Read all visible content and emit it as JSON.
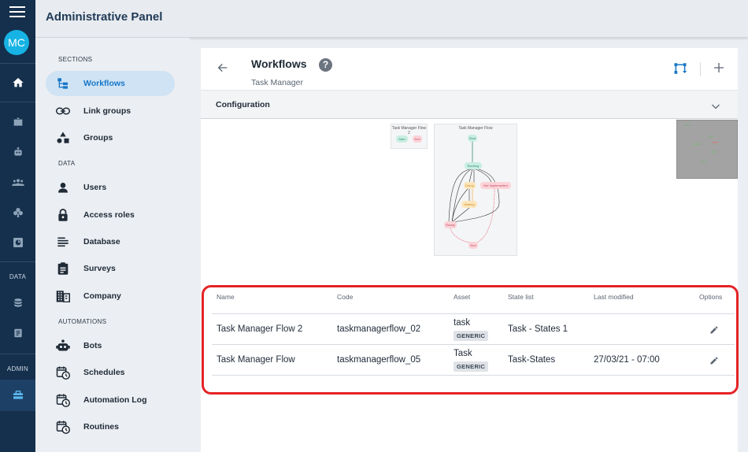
{
  "app": {
    "title": "Administrative Panel"
  },
  "rail": {
    "avatar_initials": "MC",
    "data_label": "DATA",
    "admin_label": "ADMIN"
  },
  "sidebar": {
    "sections_label": "SECTIONS",
    "data_label": "DATA",
    "automations_label": "AUTOMATIONS",
    "sections": [
      {
        "label": "Workflows",
        "icon": "workflow-icon",
        "active": true
      },
      {
        "label": "Link groups",
        "icon": "link-icon"
      },
      {
        "label": "Groups",
        "icon": "shapes-icon"
      }
    ],
    "data": [
      {
        "label": "Users",
        "icon": "user-icon"
      },
      {
        "label": "Access roles",
        "icon": "lock-icon"
      },
      {
        "label": "Database",
        "icon": "list-icon"
      },
      {
        "label": "Surveys",
        "icon": "clipboard-icon"
      },
      {
        "label": "Company",
        "icon": "building-icon"
      }
    ],
    "automations": [
      {
        "label": "Bots",
        "icon": "bot-icon"
      },
      {
        "label": "Schedules",
        "icon": "calendar-clock-icon"
      },
      {
        "label": "Automation Log",
        "icon": "calendar-clock-icon"
      },
      {
        "label": "Routines",
        "icon": "calendar-clock-icon"
      }
    ]
  },
  "page": {
    "title": "Workflows",
    "subtitle": "Task Manager",
    "config_label": "Configuration"
  },
  "graph": {
    "flow2": {
      "title": "Task Manager Flow 2",
      "nodes": [
        "Start",
        "End"
      ]
    },
    "flow1": {
      "title": "Task Manager Flow",
      "nodes": [
        "Start",
        "Backlog",
        "Doing",
        "Not Implemented",
        "Waiting",
        "Ready",
        "End"
      ]
    }
  },
  "table": {
    "headers": [
      "Name",
      "Code",
      "Asset",
      "State list",
      "Last modified",
      "Options"
    ],
    "rows": [
      {
        "name": "Task Manager Flow 2",
        "code": "taskmanagerflow_02",
        "asset": "task",
        "asset_badge": "GENERIC",
        "state_list": "Task - States 1",
        "last_modified": ""
      },
      {
        "name": "Task Manager Flow",
        "code": "taskmanagerflow_05",
        "asset": "Task",
        "asset_badge": "GENERIC",
        "state_list": "Task-States",
        "last_modified": "27/03/21 - 07:00"
      }
    ]
  },
  "colors": {
    "accent": "#1877c8",
    "rail": "#14304d",
    "highlight": "#e52326"
  }
}
